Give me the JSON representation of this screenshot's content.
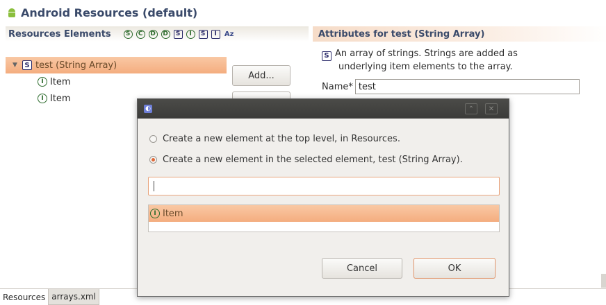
{
  "page": {
    "title": "Android Resources (default)"
  },
  "left_panel": {
    "header": "Resources Elements",
    "toolbar": [
      {
        "glyph": "S",
        "icon": "string-circle-icon"
      },
      {
        "glyph": "C",
        "icon": "color-icon"
      },
      {
        "glyph": "D",
        "icon": "dimension-icon"
      },
      {
        "glyph": "D",
        "icon": "drawable-icon"
      },
      {
        "glyph": "S",
        "icon": "style-icon"
      },
      {
        "glyph": "I",
        "icon": "item-icon"
      },
      {
        "glyph": "S",
        "icon": "string-array-icon"
      },
      {
        "glyph": "I",
        "icon": "integer-array-icon"
      },
      {
        "glyph": "Az",
        "icon": "sort-alpha-icon"
      }
    ],
    "tree": {
      "root": {
        "label": "test (String Array)",
        "badge": "S"
      },
      "children": [
        {
          "label": "Item",
          "badge": "I"
        },
        {
          "label": "Item",
          "badge": "I"
        }
      ]
    },
    "add_button_label": "Add..."
  },
  "right_panel": {
    "header": "Attributes for test (String Array)",
    "badge": "S",
    "description_line1": "An array of strings. Strings are added as",
    "description_line2": "underlying item elements to the array.",
    "name_label": "Name*",
    "name_value": "test"
  },
  "dialog": {
    "app_icon": "eclipse-icon",
    "radio_top_level": "Create a new element at the top level, in Resources.",
    "radio_selected": "Create a new element in the selected element, test (String Array).",
    "selected_option": "selected",
    "filter_value": "",
    "list_items": [
      {
        "label": "Item",
        "badge": "I"
      }
    ],
    "cancel_label": "Cancel",
    "ok_label": "OK"
  },
  "bottom_tabs": [
    {
      "label": "Resources",
      "active": true
    },
    {
      "label": "arrays.xml",
      "active": false
    }
  ],
  "colors": {
    "selection": "#f4ad7f",
    "header_text": "#3a4a6a",
    "radio_accent": "#e06a3a"
  }
}
